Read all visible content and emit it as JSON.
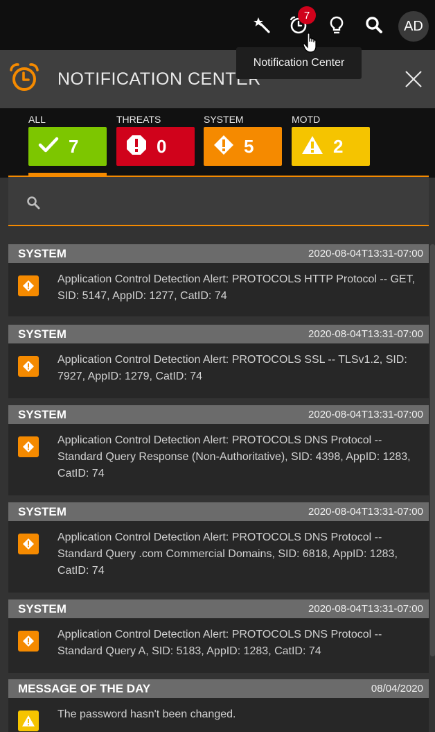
{
  "topbar": {
    "notification_count": "7",
    "avatar_initials": "AD",
    "icons": [
      "magic-wand-icon",
      "alarm-clock-icon",
      "lightbulb-icon",
      "search-icon"
    ]
  },
  "tooltip": "Notification Center",
  "panel": {
    "title": "NOTIFICATION CENTER",
    "accent_color": "#f58a00"
  },
  "filters": [
    {
      "label": "ALL",
      "count": "7",
      "color": "#7dc600",
      "icon": "check-icon"
    },
    {
      "label": "THREATS",
      "count": "0",
      "color": "#d0021b",
      "icon": "alert-octagon-icon"
    },
    {
      "label": "SYSTEM",
      "count": "5",
      "color": "#f58a00",
      "icon": "alert-diamond-icon"
    },
    {
      "label": "MOTD",
      "count": "2",
      "color": "#f5c400",
      "icon": "warning-triangle-icon"
    }
  ],
  "search": {
    "placeholder": ""
  },
  "notifications": [
    {
      "category": "SYSTEM",
      "time": "2020-08-04T13:31-07:00",
      "text": "Application Control Detection Alert: PROTOCOLS HTTP Protocol -- GET, SID: 5147, AppID: 1277, CatID: 74"
    },
    {
      "category": "SYSTEM",
      "time": "2020-08-04T13:31-07:00",
      "text": "Application Control Detection Alert: PROTOCOLS SSL -- TLSv1.2, SID: 7927, AppID: 1279, CatID: 74"
    },
    {
      "category": "SYSTEM",
      "time": "2020-08-04T13:31-07:00",
      "text": "Application Control Detection Alert: PROTOCOLS DNS Protocol -- Standard Query Response (Non-Authoritative), SID: 4398, AppID: 1283, CatID: 74"
    },
    {
      "category": "SYSTEM",
      "time": "2020-08-04T13:31-07:00",
      "text": "Application Control Detection Alert: PROTOCOLS DNS Protocol -- Standard Query .com Commercial Domains, SID: 6818, AppID: 1283, CatID: 74"
    },
    {
      "category": "SYSTEM",
      "time": "2020-08-04T13:31-07:00",
      "text": "Application Control Detection Alert: PROTOCOLS DNS Protocol -- Standard Query A, SID: 5183, AppID: 1283, CatID: 74"
    },
    {
      "category": "MESSAGE OF THE DAY",
      "time": "08/04/2020",
      "text": "The password hasn't been changed."
    }
  ]
}
